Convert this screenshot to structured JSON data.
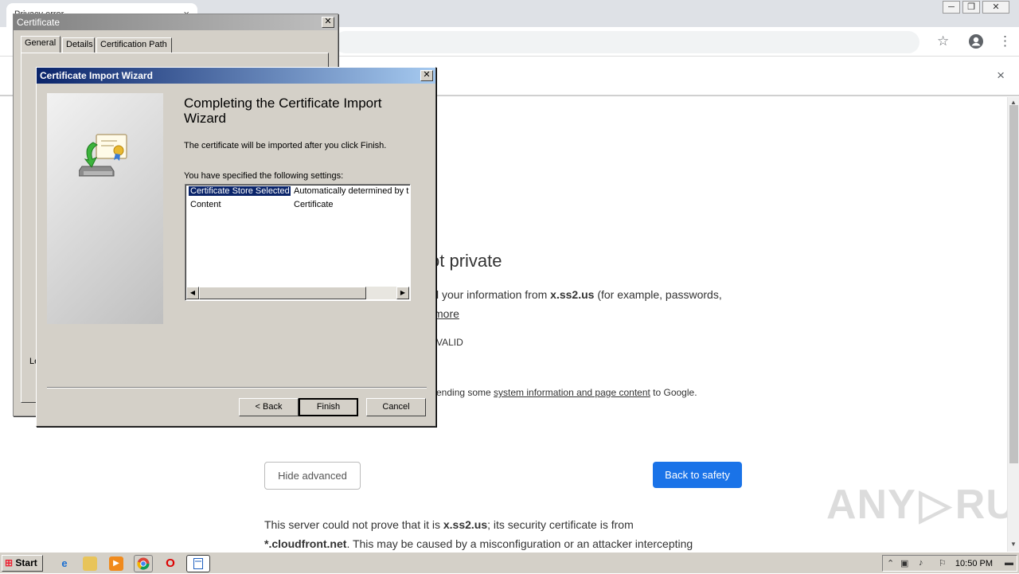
{
  "browser": {
    "tab_title": "Privacy error",
    "tab_close": "×",
    "win_min": "─",
    "win_max": "❐",
    "win_close": "✕",
    "infobar_close": "×"
  },
  "page": {
    "heading": "ot private",
    "line1_pre": "l your information from ",
    "line1_domain": "x.ss2.us",
    "line1_post": " (for example, passwords,",
    "learn_more": " more",
    "error_code": "VALID",
    "report_pre": "ending some ",
    "report_link": "system information and page content",
    "report_post": " to Google.",
    "hide_advanced": "Hide advanced",
    "back_to_safety": "Back to safety",
    "detail1_pre": "This server could not prove that it is ",
    "detail1_domain": "x.ss2.us",
    "detail1_post": "; its security certificate is from",
    "detail2_domain": "*.cloudfront.net",
    "detail2_post": ". This may be caused by a misconfiguration or an attacker intercepting"
  },
  "watermark": {
    "left": "ANY",
    "right": "RUN"
  },
  "cert_dialog": {
    "title": "Certificate",
    "close": "✕",
    "tabs": [
      "General",
      "Details",
      "Certification Path"
    ],
    "footer_fragment": "Le"
  },
  "wizard": {
    "title": "Certificate Import Wizard",
    "close": "✕",
    "heading": "Completing the Certificate Import Wizard",
    "finish_note": "The certificate will be imported after you click Finish.",
    "settings_label": "You have specified the following settings:",
    "settings": [
      {
        "name": "Certificate Store Selected",
        "value": "Automatically determined by t"
      },
      {
        "name": "Content",
        "value": "Certificate"
      }
    ],
    "back": "< Back",
    "finish": "Finish",
    "cancel": "Cancel"
  },
  "taskbar": {
    "start": "Start",
    "clock": "10:50 PM"
  }
}
